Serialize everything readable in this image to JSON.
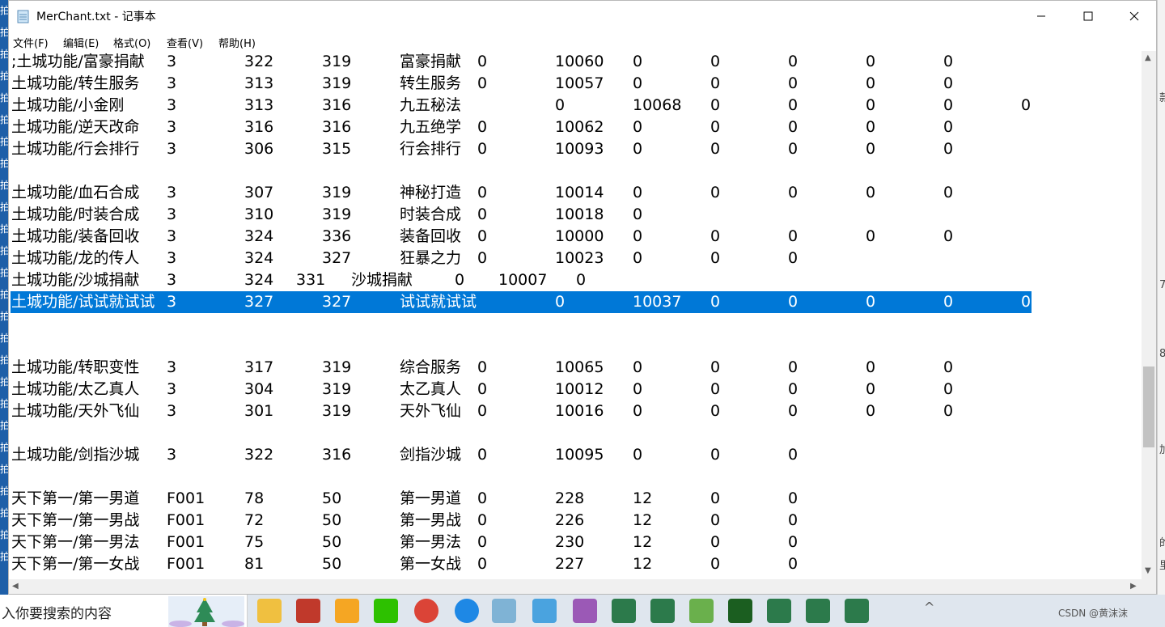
{
  "window": {
    "title": "MerChant.txt - 记事本",
    "menu": [
      "文件(F)",
      "编辑(E)",
      "格式(O)",
      "查看(V)",
      "帮助(H)"
    ]
  },
  "colors": {
    "selection": "#0078d7",
    "left_strip": "#1e5fa8",
    "taskbar": "#dfe6ee"
  },
  "left_strip_glyphs": [
    "拍",
    "拍",
    "拍",
    "拍",
    "拍",
    "拍",
    "拍",
    "拍",
    "拍",
    "拍",
    "拍",
    "拍",
    "拍",
    "拍",
    "拍",
    "拍",
    "拍",
    "拍",
    "拍",
    "拍",
    "拍",
    "拍",
    "拍",
    "拍",
    "拍",
    "拍"
  ],
  "right_strip_glyphs": [
    "款",
    "7",
    "8",
    "加",
    "的",
    "里"
  ],
  "lines": [
    {
      "cells": [
        ";土城功能/富豪捐献",
        "3",
        "322",
        "319",
        "富豪捐献",
        "0",
        "10060",
        "0",
        "0",
        "0",
        "0",
        "0"
      ]
    },
    {
      "cells": [
        "土城功能/转生服务",
        "3",
        "313",
        "319",
        "转生服务",
        "0",
        "10057",
        "0",
        "0",
        "0",
        "0",
        "0"
      ]
    },
    {
      "cells": [
        "土城功能/小金刚",
        "3",
        "313",
        "316",
        "九五秘法",
        "",
        "0",
        "10068",
        "0",
        "0",
        "0",
        "0",
        "0"
      ]
    },
    {
      "cells": [
        "土城功能/逆天改命",
        "3",
        "316",
        "316",
        "九五绝学",
        "0",
        "10062",
        "0",
        "0",
        "0",
        "0",
        "0"
      ]
    },
    {
      "cells": [
        "土城功能/行会排行",
        "3",
        "306",
        "315",
        "行会排行",
        "0",
        "10093",
        "0",
        "0",
        "0",
        "0",
        "0"
      ]
    },
    {
      "cells": []
    },
    {
      "cells": [
        "土城功能/血石合成",
        "3",
        "307",
        "319",
        "神秘打造",
        "0",
        "10014",
        "0",
        "0",
        "0",
        "0",
        "0"
      ]
    },
    {
      "cells": [
        "土城功能/时装合成",
        "3",
        "310",
        "319",
        "时装合成",
        "0",
        "10018",
        "0"
      ]
    },
    {
      "cells": [
        "土城功能/装备回收",
        "3",
        "324",
        "336",
        "装备回收",
        "0",
        "10000",
        "0",
        "0",
        "0",
        "0",
        "0"
      ]
    },
    {
      "cells": [
        "土城功能/龙的传人",
        "3",
        "324",
        "327",
        "狂暴之力",
        "0",
        "10023",
        "0",
        "0",
        "0"
      ]
    },
    {
      "cells": [
        "土城功能/沙城捐献",
        "3",
        "324",
        "331",
        "沙城捐献",
        "0",
        "10007",
        "0"
      ]
    },
    {
      "cells": [
        "土城功能/试试就试试",
        "3",
        "327",
        "327",
        "试试就试试",
        "",
        "0",
        "10037",
        "0",
        "0",
        "0",
        "0",
        "0"
      ],
      "selected": true
    },
    {
      "cells": []
    },
    {
      "cells": []
    },
    {
      "cells": [
        "土城功能/转职变性",
        "3",
        "317",
        "319",
        "综合服务",
        "0",
        "10065",
        "0",
        "0",
        "0",
        "0",
        "0"
      ]
    },
    {
      "cells": [
        "土城功能/太乙真人",
        "3",
        "304",
        "319",
        "太乙真人",
        "0",
        "10012",
        "0",
        "0",
        "0",
        "0",
        "0"
      ]
    },
    {
      "cells": [
        "土城功能/天外飞仙",
        "3",
        "301",
        "319",
        "天外飞仙",
        "0",
        "10016",
        "0",
        "0",
        "0",
        "0",
        "0"
      ]
    },
    {
      "cells": []
    },
    {
      "cells": [
        "土城功能/剑指沙城",
        "3",
        "322",
        "316",
        "剑指沙城",
        "0",
        "10095",
        "0",
        "0",
        "0"
      ]
    },
    {
      "cells": []
    },
    {
      "cells": [
        "天下第一/第一男道",
        "F001",
        "78",
        "50",
        "第一男道",
        "0",
        "228",
        "12",
        "0",
        "0"
      ]
    },
    {
      "cells": [
        "天下第一/第一男战",
        "F001",
        "72",
        "50",
        "第一男战",
        "0",
        "226",
        "12",
        "0",
        "0"
      ]
    },
    {
      "cells": [
        "天下第一/第一男法",
        "F001",
        "75",
        "50",
        "第一男法",
        "0",
        "230",
        "12",
        "0",
        "0"
      ]
    },
    {
      "cells": [
        "天下第一/第一女战",
        "F001",
        "81",
        "50",
        "第一女战",
        "0",
        "227",
        "12",
        "0",
        "0"
      ]
    }
  ],
  "taskbar": {
    "search_placeholder": "入你要搜索的内容",
    "apps": [
      "explorer-icon",
      "game-icon",
      "panda-icon",
      "wechat-icon",
      "chrome-icon",
      "chat-icon",
      "notepad-icon",
      "pinwheel-icon",
      "dbc-icon",
      "app-icon",
      "app-icon",
      "leaf-icon",
      "mu-icon",
      "app-icon",
      "app-icon",
      "app-icon"
    ],
    "tray": [
      "^",
      "CSDN @黄沫沫"
    ]
  }
}
